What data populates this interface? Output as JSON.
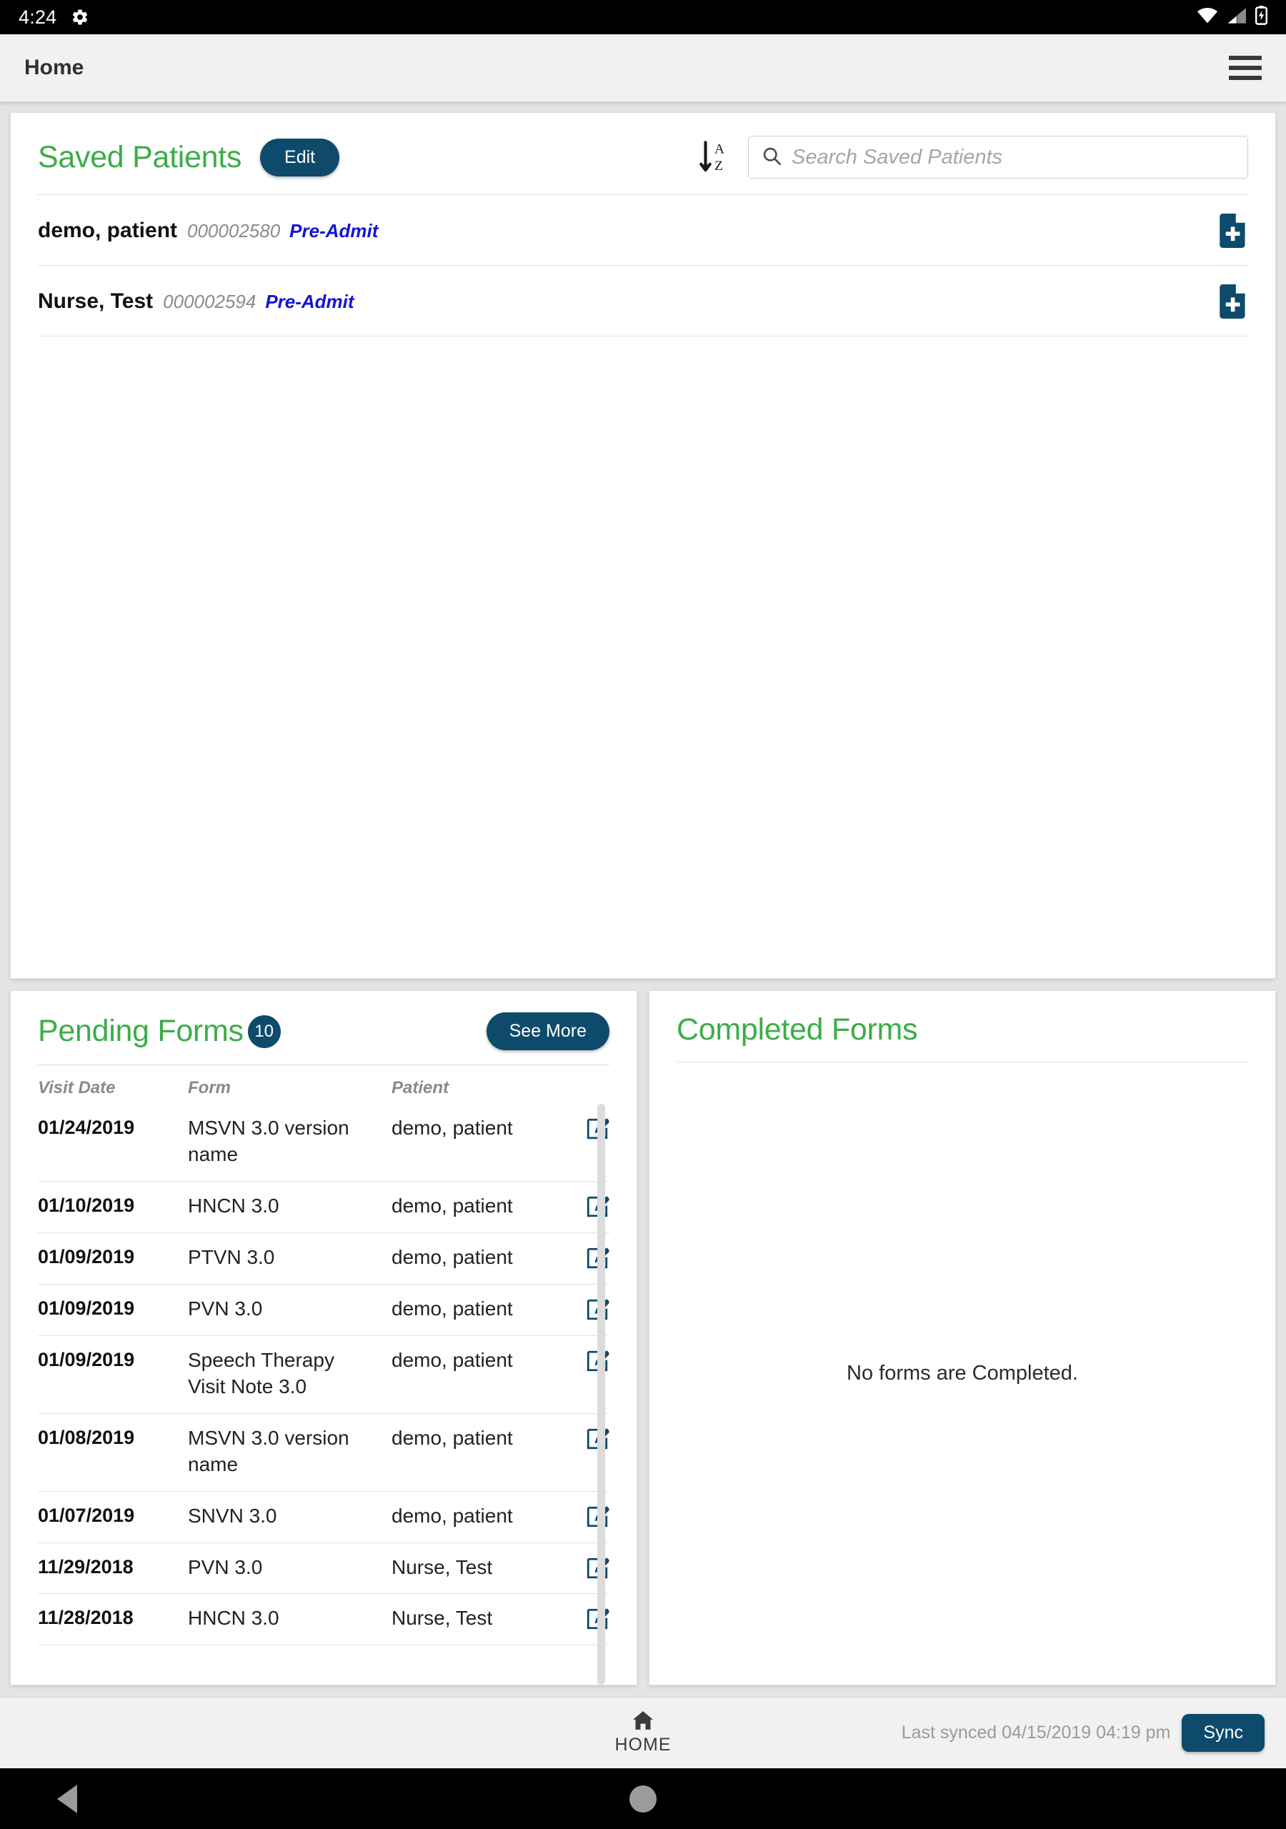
{
  "statusbar": {
    "time": "4:24",
    "gear_icon": "gear-icon",
    "wifi_icon": "wifi-icon",
    "signal_icon": "cell-signal-icon",
    "battery_icon": "battery-charging-icon"
  },
  "appbar": {
    "title": "Home",
    "menu_icon": "hamburger-menu-icon"
  },
  "colors": {
    "green": "#3cad49",
    "navy": "#0e4a6b",
    "blue_status": "#1414d8",
    "gray_text": "#8c8c8c"
  },
  "saved_patients": {
    "title": "Saved Patients",
    "edit_label": "Edit",
    "sort_icon": "sort-az-descending-icon",
    "search": {
      "placeholder": "Search Saved Patients",
      "value": "",
      "icon": "search-icon"
    },
    "rows": [
      {
        "name": "demo, patient",
        "mrn": "000002580",
        "status": "Pre-Admit",
        "action_icon": "document-add-icon"
      },
      {
        "name": "Nurse, Test",
        "mrn": "000002594",
        "status": "Pre-Admit",
        "action_icon": "document-add-icon"
      }
    ]
  },
  "pending_forms": {
    "title": "Pending Forms",
    "count": "10",
    "see_more_label": "See More",
    "columns": {
      "date": "Visit Date",
      "form": "Form",
      "patient": "Patient"
    },
    "rows": [
      {
        "date": "01/24/2019",
        "form": "MSVN 3.0 version name",
        "patient": "demo, patient",
        "action_icon": "edit-form-icon"
      },
      {
        "date": "01/10/2019",
        "form": "HNCN 3.0",
        "patient": "demo, patient",
        "action_icon": "edit-form-icon"
      },
      {
        "date": "01/09/2019",
        "form": "PTVN 3.0",
        "patient": "demo, patient",
        "action_icon": "edit-form-icon"
      },
      {
        "date": "01/09/2019",
        "form": "PVN 3.0",
        "patient": "demo, patient",
        "action_icon": "edit-form-icon"
      },
      {
        "date": "01/09/2019",
        "form": "Speech Therapy Visit Note 3.0",
        "patient": "demo, patient",
        "action_icon": "edit-form-icon"
      },
      {
        "date": "01/08/2019",
        "form": "MSVN 3.0 version name",
        "patient": "demo, patient",
        "action_icon": "edit-form-icon"
      },
      {
        "date": "01/07/2019",
        "form": "SNVN 3.0",
        "patient": "demo, patient",
        "action_icon": "edit-form-icon"
      },
      {
        "date": "11/29/2018",
        "form": "PVN 3.0",
        "patient": "Nurse, Test",
        "action_icon": "edit-form-icon"
      },
      {
        "date": "11/28/2018",
        "form": "HNCN 3.0",
        "patient": "Nurse, Test",
        "action_icon": "edit-form-icon"
      }
    ]
  },
  "completed_forms": {
    "title": "Completed Forms",
    "empty_message": "No forms are Completed."
  },
  "bottombar": {
    "home_label": "HOME",
    "home_icon": "home-icon",
    "last_synced": "Last synced 04/15/2019 04:19 pm",
    "sync_label": "Sync"
  },
  "androidnav": {
    "back_icon": "back-triangle-icon",
    "home_icon": "home-circle-icon"
  }
}
